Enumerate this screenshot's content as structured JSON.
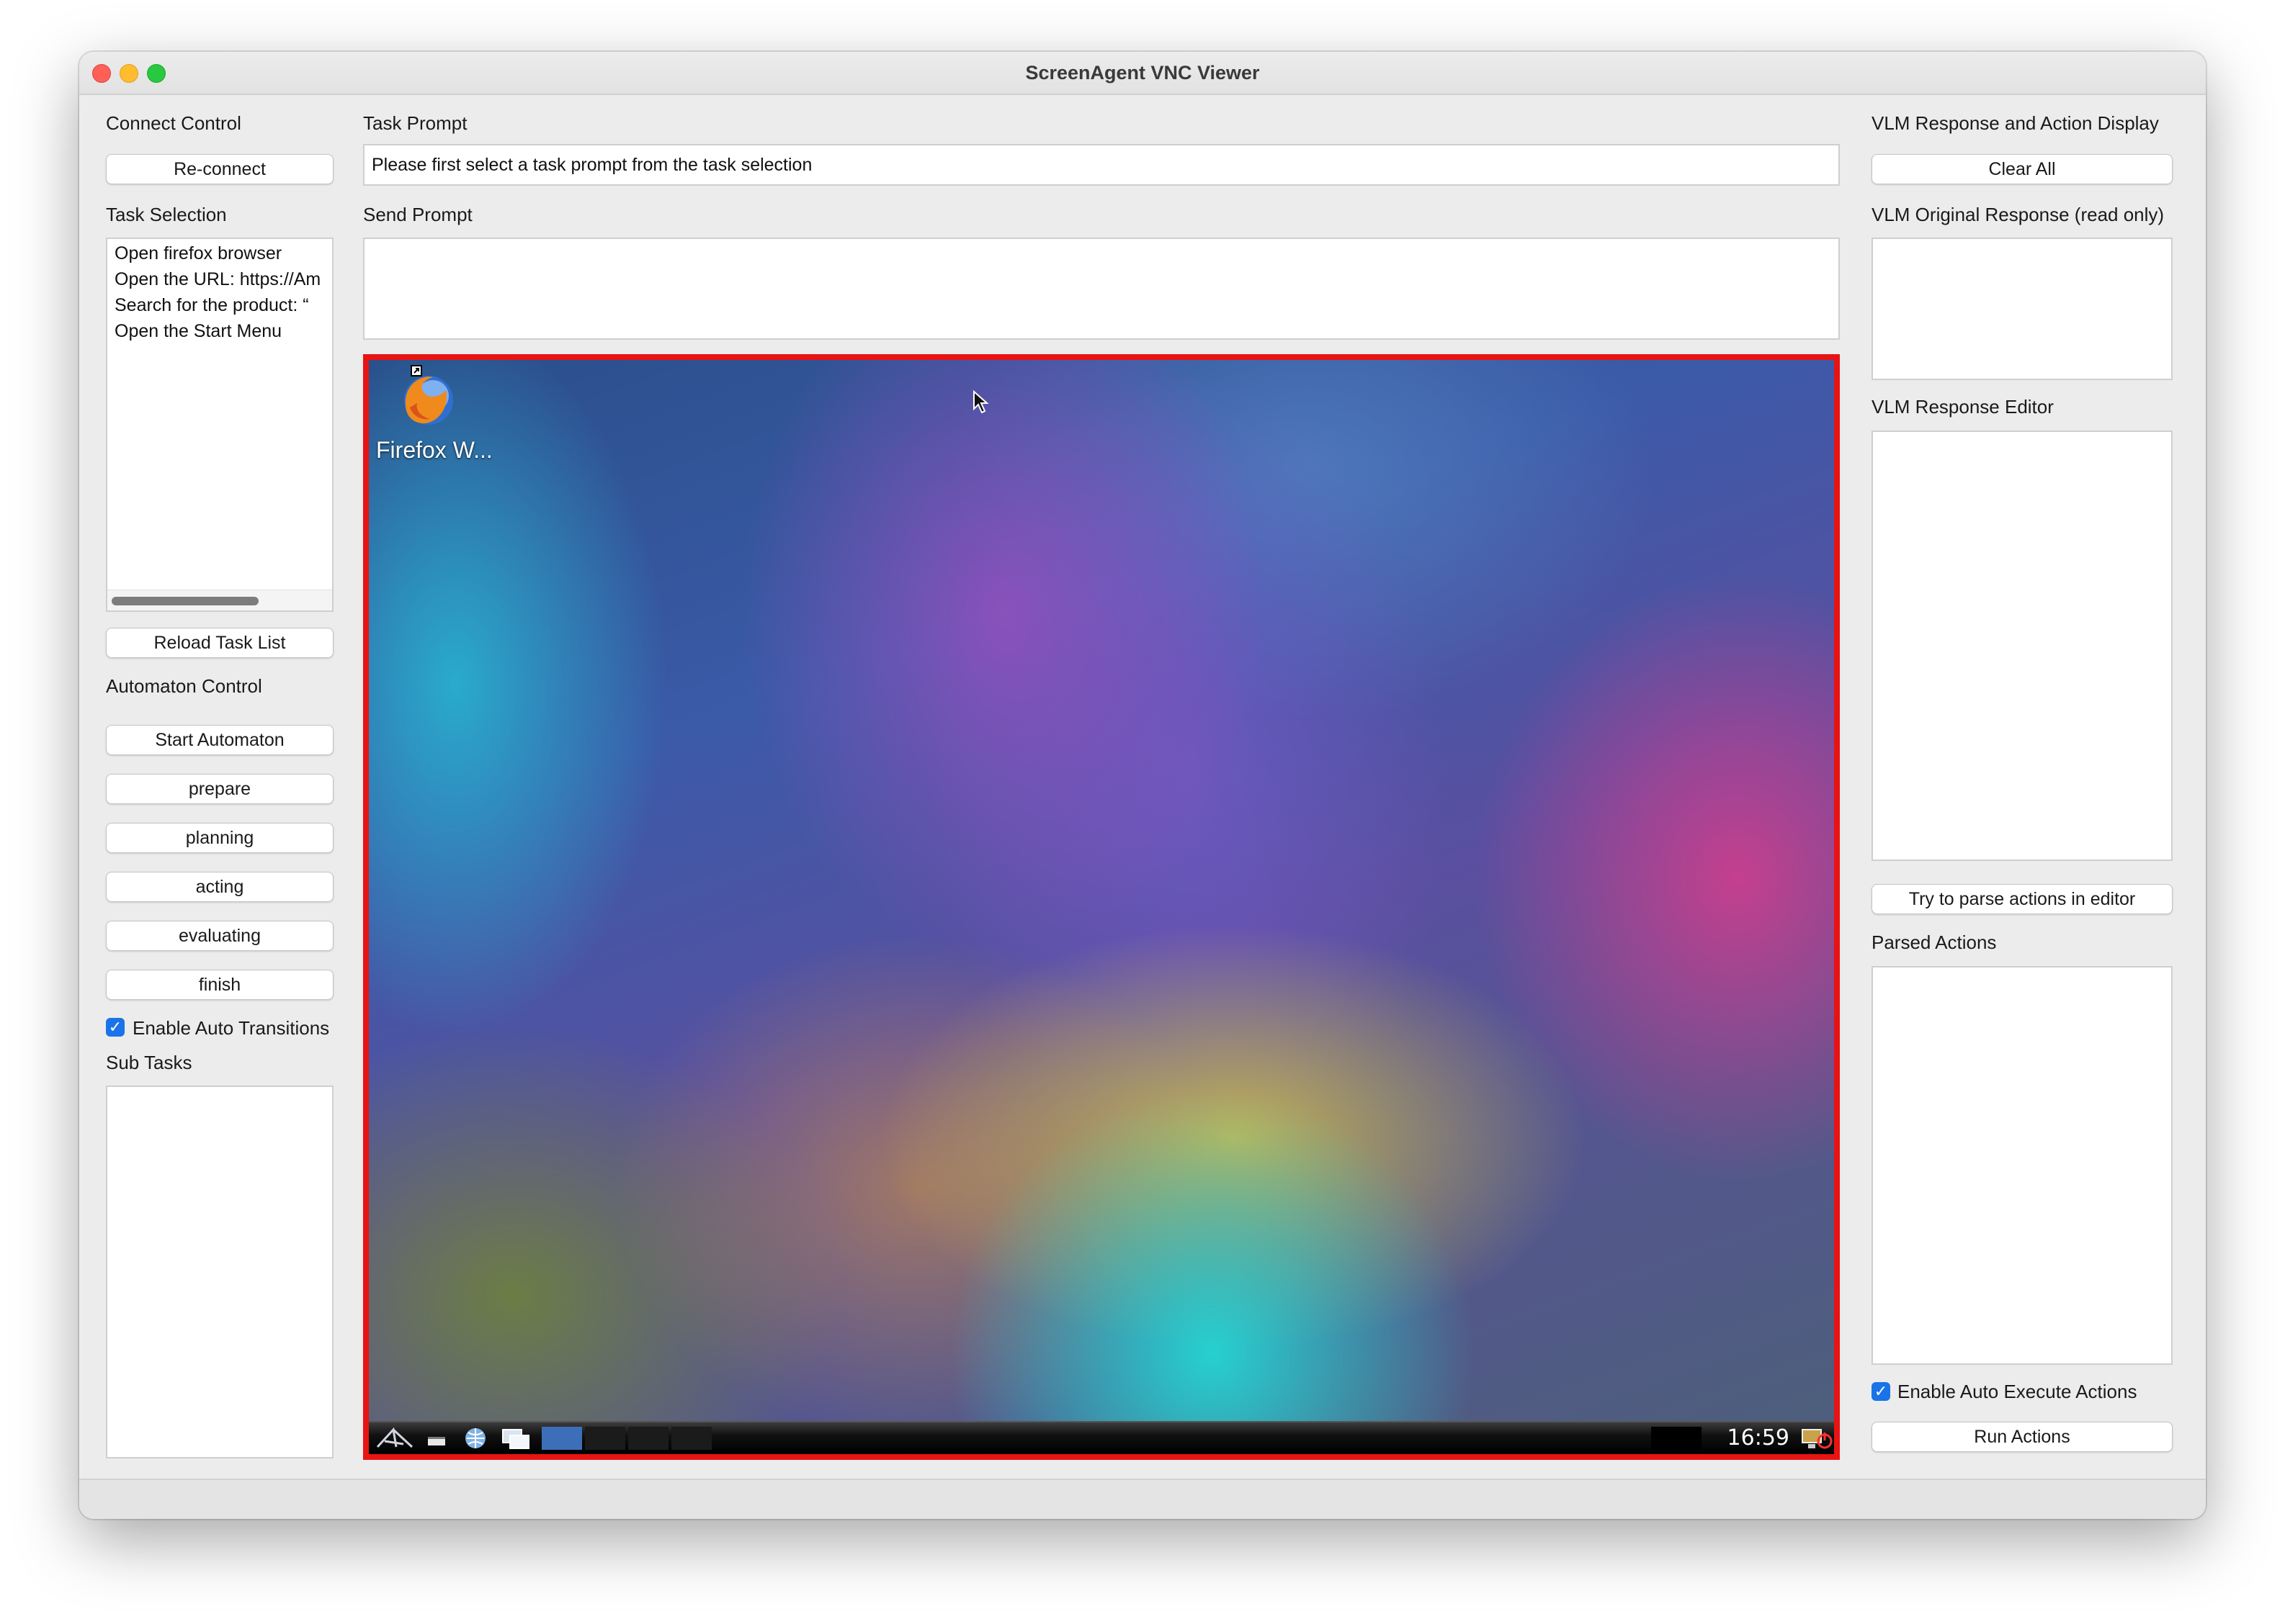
{
  "window": {
    "title": "ScreenAgent VNC Viewer"
  },
  "left": {
    "connect_control_label": "Connect Control",
    "reconnect_button": "Re-connect",
    "task_selection_label": "Task Selection",
    "tasks": [
      "Open firefox browser",
      "Open the URL: https://Am",
      "Search for the product: “",
      "Open the Start Menu"
    ],
    "reload_button": "Reload Task List",
    "automaton_control_label": "Automaton Control",
    "start_button": "Start Automaton",
    "states": [
      "prepare",
      "planning",
      "acting",
      "evaluating",
      "finish"
    ],
    "auto_transitions_label": "Enable Auto Transitions",
    "auto_transitions_checked": true,
    "sub_tasks_label": "Sub Tasks"
  },
  "center": {
    "task_prompt_label": "Task Prompt",
    "task_prompt_value": "Please first select a task prompt from the task selection",
    "send_prompt_label": "Send Prompt",
    "send_prompt_value": "",
    "vnc": {
      "desktop_icon_label": "Firefox W...",
      "clock": "16:59",
      "border_color": "#e81313"
    }
  },
  "right": {
    "header_label": "VLM Response and Action Display",
    "clear_all_button": "Clear All",
    "original_response_label": "VLM Original Response (read only)",
    "response_editor_label": "VLM Response Editor",
    "parse_button": "Try to parse actions in editor",
    "parsed_actions_label": "Parsed Actions",
    "auto_execute_label": "Enable Auto Execute Actions",
    "auto_execute_checked": true,
    "run_actions_button": "Run Actions"
  }
}
